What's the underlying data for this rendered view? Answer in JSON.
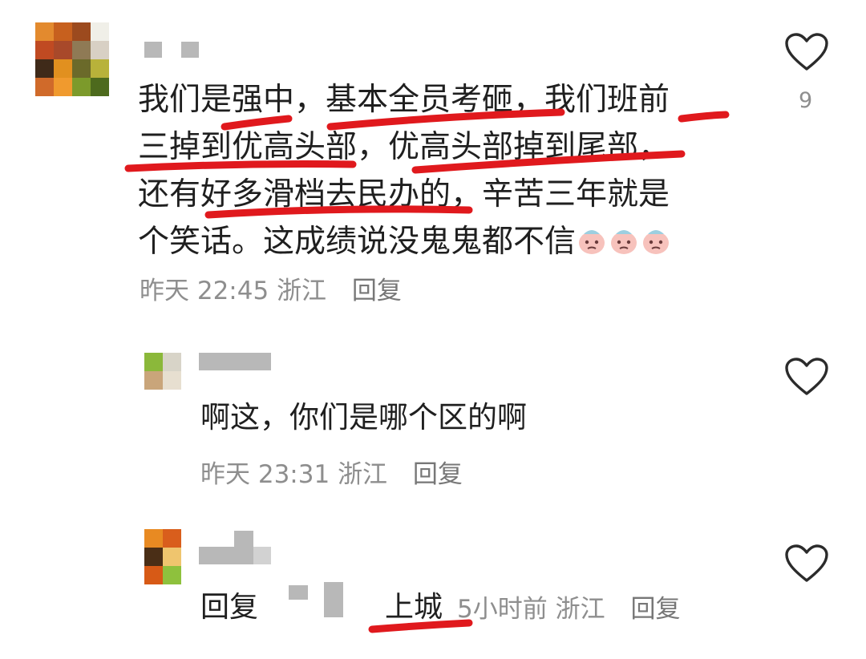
{
  "comments": [
    {
      "text": "我们是强中，基本全员考砸，我们班前\n三掉到优高头部，优高头部掉到尾部，\n还有好多滑档去民办的，辛苦三年就是\n个笑话。这成绩说没鬼鬼都不信",
      "time": "昨天 22:45",
      "location": "浙江",
      "reply_label": "回复",
      "like_count": "9"
    },
    {
      "text": "啊这，你们是哪个区的啊",
      "time": "昨天 23:31",
      "location": "浙江",
      "reply_label": "回复"
    },
    {
      "reply_prefix": "回复",
      "text": "上城",
      "time": "5小时前",
      "location": "浙江",
      "reply_label": "回复"
    }
  ],
  "icons": {
    "like": "heart-outline-icon",
    "emoji": "crying-face-emoji"
  },
  "colors": {
    "highlight_marker": "#e0191d",
    "meta_text": "#8e8e8e"
  }
}
